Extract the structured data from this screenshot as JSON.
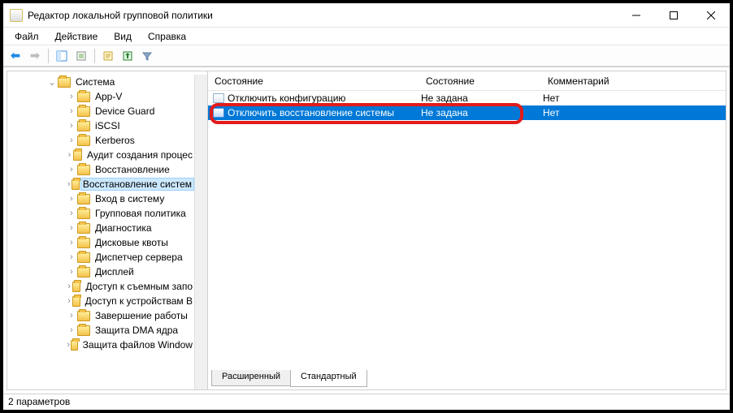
{
  "window": {
    "title": "Редактор локальной групповой политики"
  },
  "menu": {
    "file": "Файл",
    "action": "Действие",
    "view": "Вид",
    "help": "Справка"
  },
  "tree": {
    "root": "Система",
    "items": [
      "App-V",
      "Device Guard",
      "iSCSI",
      "Kerberos",
      "Аудит создания процес",
      "Восстановление",
      "Восстановление систем",
      "Вход в систему",
      "Групповая политика",
      "Диагностика",
      "Дисковые квоты",
      "Диспетчер сервера",
      "Дисплей",
      "Доступ к съемным запо",
      "Доступ к устройствам B",
      "Завершение работы",
      "Защита DMA ядра",
      "Защита файлов Window"
    ],
    "selected_index": 6
  },
  "columns": {
    "state_header1": "Состояние",
    "state_header2": "Состояние",
    "comment_header": "Комментарий"
  },
  "rows": [
    {
      "name": "Отключить конфигурацию",
      "state": "Не задана",
      "comment": "Нет"
    },
    {
      "name": "Отключить восстановление системы",
      "state": "Не задана",
      "comment": "Нет"
    }
  ],
  "selected_row": 1,
  "tabs": {
    "extended": "Расширенный",
    "standard": "Стандартный"
  },
  "status": "2 параметров"
}
